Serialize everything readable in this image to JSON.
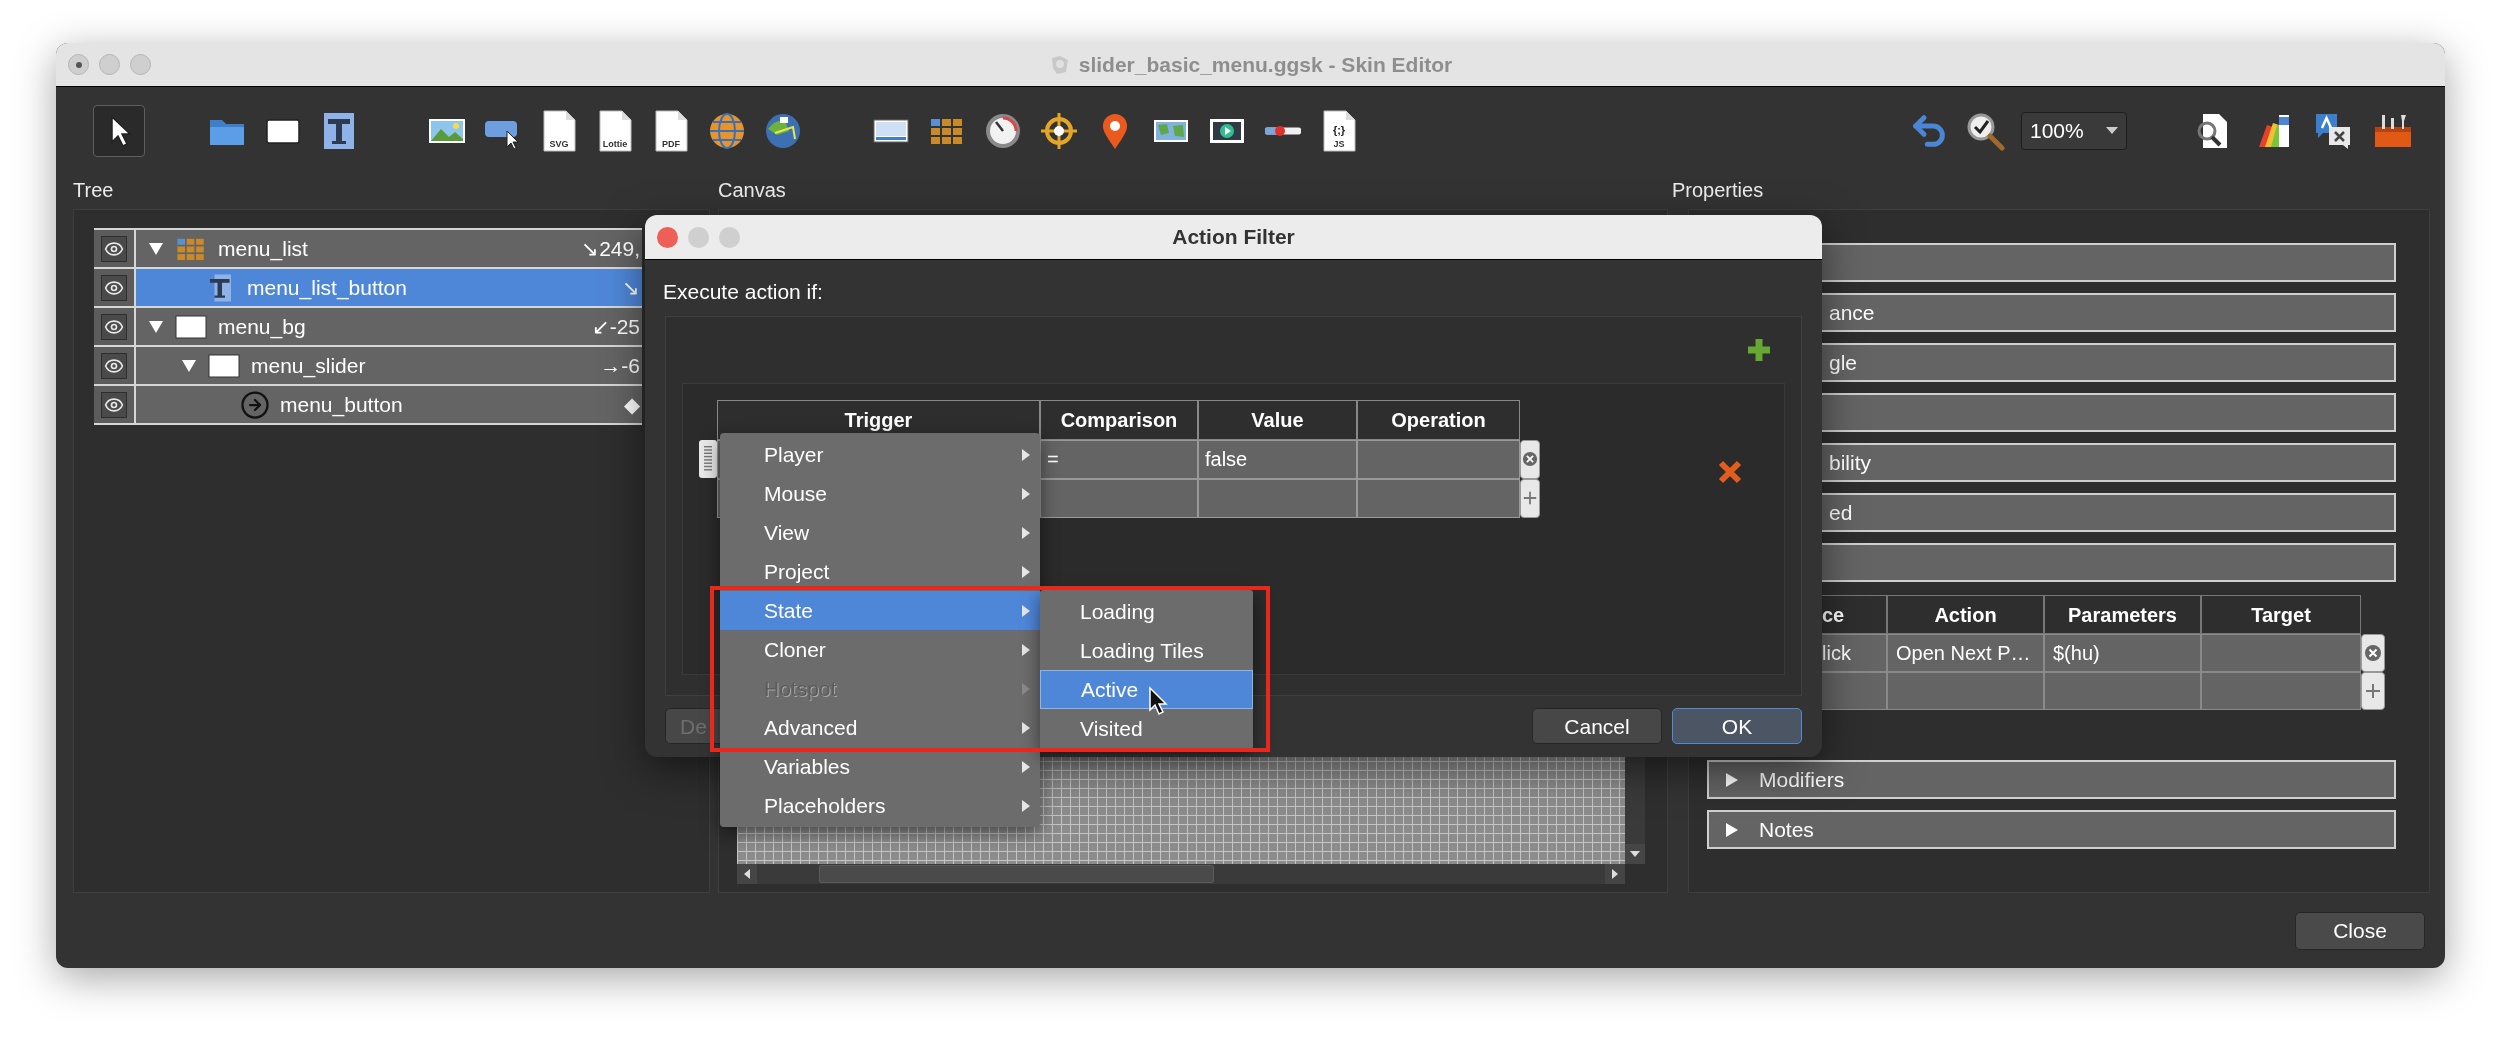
{
  "window": {
    "title": "slider_basic_menu.ggsk - Skin Editor"
  },
  "toolbar": {
    "tool_groups": [
      [
        {
          "kind": "pointer",
          "selected": true
        }
      ],
      [
        {
          "kind": "folder",
          "selected": false
        },
        {
          "kind": "rectangle",
          "selected": false
        },
        {
          "kind": "text",
          "selected": false
        }
      ],
      [
        {
          "kind": "image",
          "selected": false
        },
        {
          "kind": "button",
          "selected": false
        },
        {
          "kind": "doc",
          "label": "SVG",
          "selected": false
        },
        {
          "kind": "doc",
          "label": "Lottie",
          "selected": false
        },
        {
          "kind": "doc",
          "label": "PDF",
          "selected": false
        },
        {
          "kind": "globe",
          "selected": false
        },
        {
          "kind": "map-globe",
          "selected": false
        }
      ],
      [
        {
          "kind": "screen",
          "selected": false
        },
        {
          "kind": "tiles",
          "selected": false
        },
        {
          "kind": "dial",
          "selected": false
        },
        {
          "kind": "crosshair",
          "selected": false
        },
        {
          "kind": "pin",
          "selected": false
        },
        {
          "kind": "map",
          "selected": false
        },
        {
          "kind": "video",
          "selected": false
        },
        {
          "kind": "slider",
          "selected": false
        },
        {
          "kind": "doc",
          "label": "JS",
          "glyph": "{;}",
          "selected": false
        }
      ]
    ],
    "right_tools": [
      {
        "kind": "undo"
      },
      {
        "kind": "zoom"
      },
      {
        "kind": "zoom-select",
        "value": "100%"
      },
      {
        "kind": "search-doc"
      },
      {
        "kind": "palette"
      },
      {
        "kind": "translate"
      },
      {
        "kind": "toolbox"
      }
    ]
  },
  "panel_labels": [
    "Tree",
    "Canvas",
    "Properties"
  ],
  "tree": {
    "items": [
      {
        "label": "menu_list",
        "kind": "grid",
        "coords": "↘249,",
        "selected": false,
        "expanded": true,
        "children": [
          {
            "label": "menu_list_button",
            "kind": "text",
            "coords": "↘",
            "selected": true
          }
        ]
      },
      {
        "label": "menu_bg",
        "kind": "rectangle",
        "coords": "↙-25",
        "selected": false,
        "expanded": true,
        "children": [
          {
            "label": "menu_slider",
            "kind": "rectangle",
            "coords": "→-6",
            "selected": false,
            "expanded": true,
            "children": [
              {
                "label": "menu_button",
                "kind": "button",
                "coords": "◆",
                "selected": false
              }
            ]
          }
        ]
      }
    ]
  },
  "properties": {
    "sections_top": [
      {
        "kind": "blank"
      },
      {
        "kind": "titled",
        "label": "ance"
      },
      {
        "kind": "titled",
        "label": "gle"
      },
      {
        "kind": "blank"
      },
      {
        "kind": "titled",
        "label": "bility"
      },
      {
        "kind": "titled",
        "label": "ed"
      },
      {
        "kind": "blank"
      }
    ],
    "actions_table": {
      "columns": [
        "ce",
        "Action",
        "Parameters",
        "Target"
      ],
      "rows": [
        [
          "lick",
          "Open Next P…",
          "$(hu)"
        ]
      ]
    },
    "sections_bottom": [
      {
        "label": "Modifiers",
        "expanded": false
      },
      {
        "label": "Notes",
        "expanded": false
      }
    ]
  },
  "close_button": "Close",
  "dialog": {
    "title": "Action Filter",
    "prompt": "Execute action if:",
    "table": {
      "columns": [
        "Trigger",
        "Comparison",
        "Value",
        "Operation"
      ],
      "rows": [
        {
          "comparison": "=",
          "value": "false"
        }
      ]
    },
    "buttons": [
      {
        "label": "De",
        "default": false,
        "disabled": true
      },
      {
        "label": "Cancel",
        "default": false,
        "disabled": false
      },
      {
        "label": "OK",
        "default": true,
        "disabled": false
      }
    ]
  },
  "menu": {
    "items": [
      {
        "label": "Player",
        "selected": false,
        "disabled": false
      },
      {
        "label": "Mouse",
        "selected": false,
        "disabled": false
      },
      {
        "label": "View",
        "selected": false,
        "disabled": false
      },
      {
        "label": "Project",
        "selected": false,
        "disabled": false
      },
      {
        "label": "State",
        "selected": true,
        "disabled": false
      },
      {
        "label": "Cloner",
        "selected": false,
        "disabled": false
      },
      {
        "label": "Hotspot",
        "selected": false,
        "disabled": true
      },
      {
        "label": "Advanced",
        "selected": false,
        "disabled": false
      },
      {
        "label": "Variables",
        "selected": false,
        "disabled": false
      },
      {
        "label": "Placeholders",
        "selected": false,
        "disabled": false
      }
    ],
    "submenu": {
      "items": [
        {
          "label": "Loading",
          "selected": false
        },
        {
          "label": "Loading Tiles",
          "selected": false
        },
        {
          "label": "Active",
          "selected": true
        },
        {
          "label": "Visited",
          "selected": false
        }
      ]
    }
  }
}
